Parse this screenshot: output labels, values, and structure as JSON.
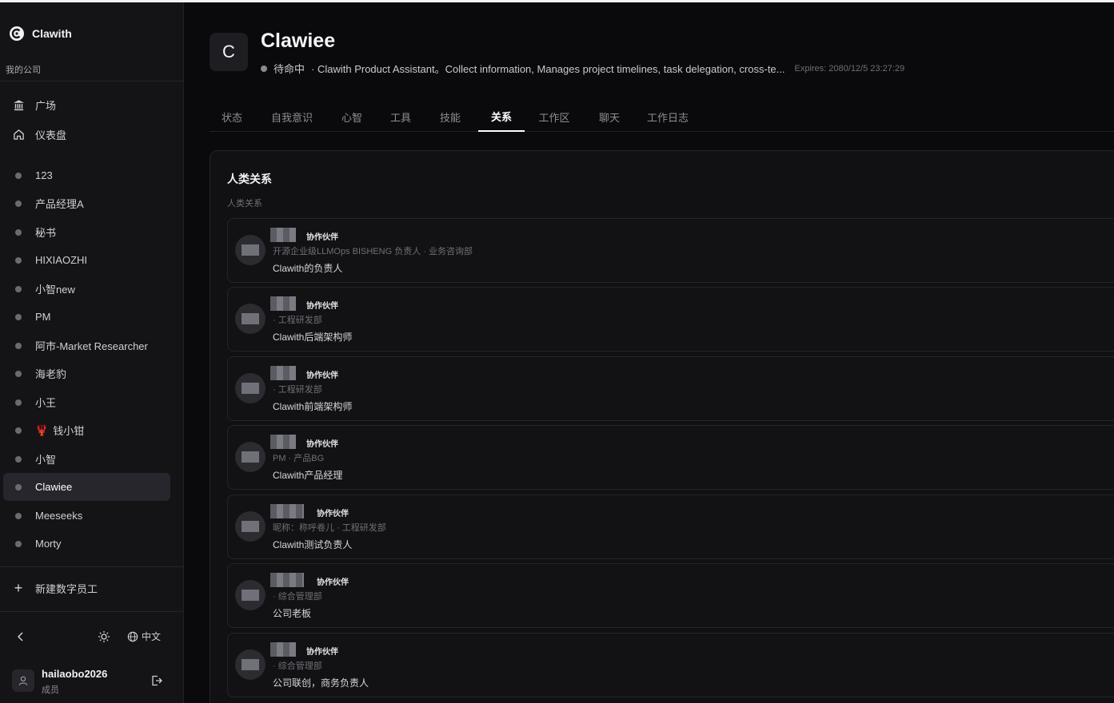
{
  "app": {
    "name": "Clawith",
    "company": "我的公司"
  },
  "nav": [
    {
      "label": "广场",
      "icon": "bank-icon"
    },
    {
      "label": "仪表盘",
      "icon": "home-icon"
    }
  ],
  "agents": [
    {
      "label": "123"
    },
    {
      "label": "产品经理A"
    },
    {
      "label": "秘书"
    },
    {
      "label": "HIXIAOZHI"
    },
    {
      "label": "小智new"
    },
    {
      "label": "PM"
    },
    {
      "label": "阿市-Market Researcher"
    },
    {
      "label": "海老豹"
    },
    {
      "label": "小王"
    },
    {
      "label": "钱小钳",
      "emoji": "🦞"
    },
    {
      "label": "小智"
    },
    {
      "label": "Clawiee",
      "active": true
    },
    {
      "label": "Meeseeks"
    },
    {
      "label": "Morty"
    }
  ],
  "new_agent_label": "新建数字员工",
  "language": "中文",
  "user": {
    "name": "hailaobo2026",
    "role": "成员"
  },
  "agent": {
    "initial": "C",
    "name": "Clawiee",
    "status": "待命中",
    "description": "· Clawith Product Assistant。Collect information, Manages project timelines, task delegation, cross-te...",
    "expires": "Expires: 2080/12/5 23:27:29"
  },
  "tabs": [
    "状态",
    "自我意识",
    "心智",
    "工具",
    "技能",
    "关系",
    "工作区",
    "聊天",
    "工作日志"
  ],
  "active_tab": "关系",
  "relations": {
    "title": "人类关系",
    "subtitle": "人类关系",
    "items": [
      {
        "badge": "协作伙伴",
        "meta": "开源企业级LLMOps BISHENG 负责人 · 业务咨询部",
        "desc": "Clawith的负责人"
      },
      {
        "badge": "协作伙伴",
        "meta": "· 工程研发部",
        "desc": "Clawith后端架构师"
      },
      {
        "badge": "协作伙伴",
        "meta": "· 工程研发部",
        "desc": "Clawith前端架构师"
      },
      {
        "badge": "协作伙伴",
        "meta": "PM · 产品BG",
        "desc": "Clawith产品经理"
      },
      {
        "badge": "协作伙伴",
        "meta": "昵称：称呼卷儿 · 工程研发部",
        "desc": "Clawith测试负责人"
      },
      {
        "badge": "协作伙伴",
        "meta": "· 综合管理部",
        "desc": "公司老板"
      },
      {
        "badge": "协作伙伴",
        "meta": "· 综合管理部",
        "desc": "公司联创，商务负责人"
      }
    ]
  }
}
